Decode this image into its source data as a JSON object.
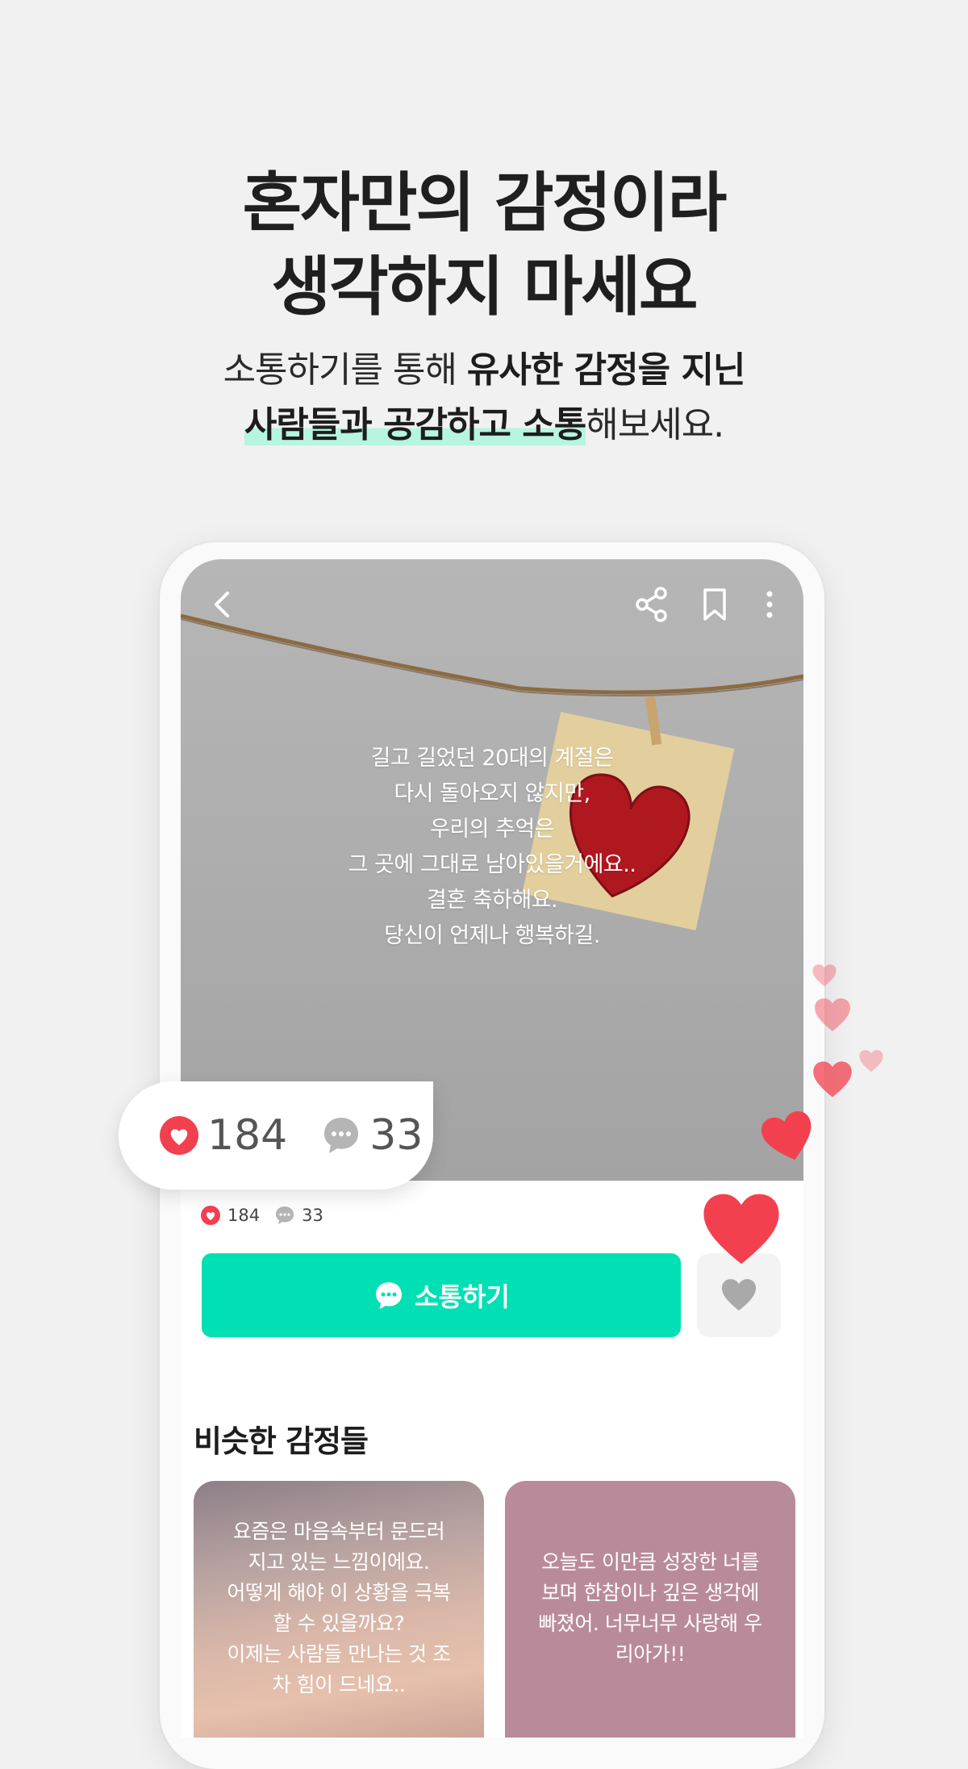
{
  "headline": {
    "line1": "혼자만의 감정이라",
    "line2": "생각하지 마세요"
  },
  "subheadline": {
    "line1_normal": "소통하기를 통해 ",
    "line1_bold": "유사한 감정을 지닌",
    "line2_highlight": "사람들과 공감하고 소통",
    "line2_normal": "해보세요."
  },
  "post": {
    "message": [
      "길고 길었던 20대의 계절은",
      "다시 돌아오지 않지만,",
      "우리의 추억은",
      "그 곳에 그대로 남아있을거에요..",
      "결혼 축하해요.",
      "당신이 언제나 행복하길."
    ],
    "likes": "184",
    "comments": "33"
  },
  "bubble": {
    "likes": "184",
    "comments": "33"
  },
  "actions": {
    "talk_label": "소통하기"
  },
  "similar": {
    "title": "비슷한 감정들",
    "cards": [
      {
        "lines": [
          "요즘은 마음속부터 문드러",
          "지고 있는 느낌이에요.",
          "어떻게 해야 이 상황을 극복",
          "할 수 있을까요?",
          "이제는 사람들 만나는 것 조",
          "차 힘이 드네요.."
        ]
      },
      {
        "lines": [
          "오늘도 이만큼 성장한 너를",
          "보며 한참이나 깊은 생각에",
          "빠졌어. 너무너무 사랑해 우",
          "리아가!!"
        ]
      }
    ]
  },
  "colors": {
    "accent": "#00e0b4",
    "heart": "#f2404f",
    "highlight": "#b6f5df"
  },
  "icons": [
    "back-icon",
    "share-icon",
    "bookmark-icon",
    "more-icon",
    "heart-icon",
    "comment-icon"
  ]
}
